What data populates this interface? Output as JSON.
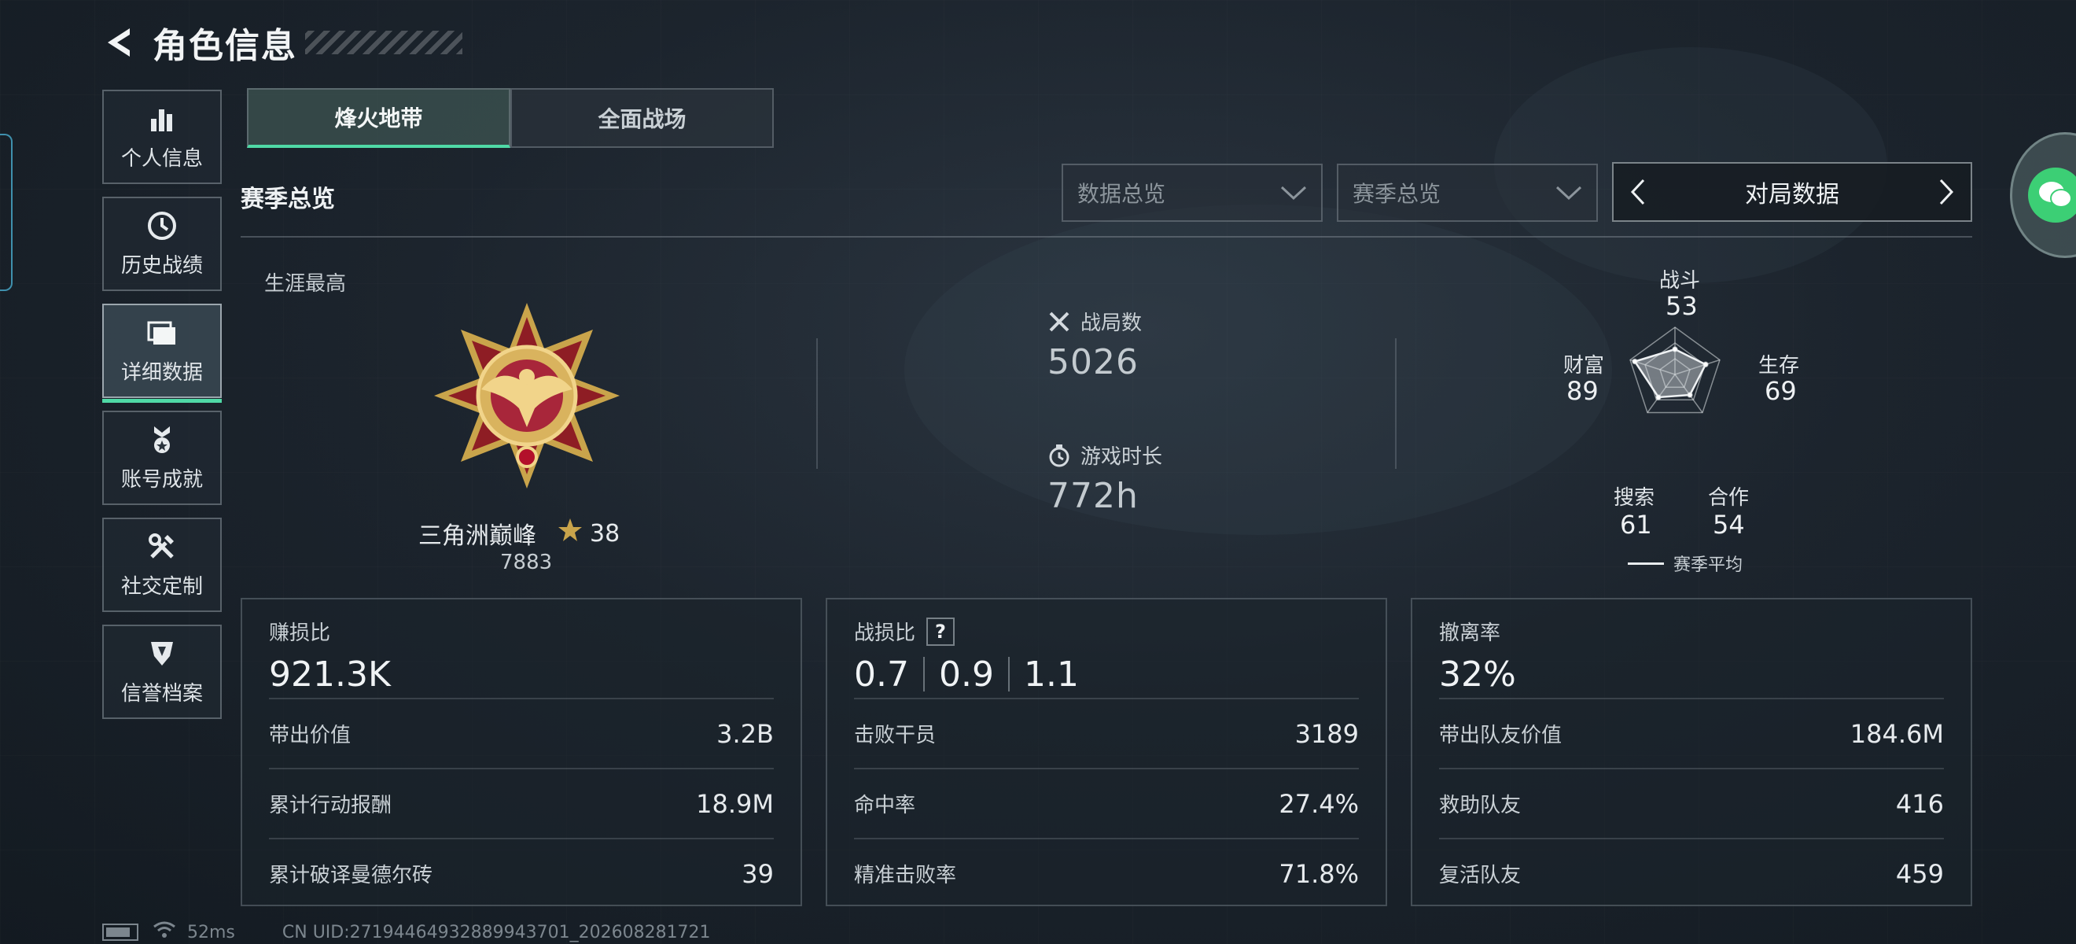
{
  "header": {
    "title": "角色信息"
  },
  "nav": {
    "items": [
      {
        "label": "个人信息",
        "icon": "bar-chart-icon"
      },
      {
        "label": "历史战绩",
        "icon": "clock-icon"
      },
      {
        "label": "详细数据",
        "icon": "folder-icon",
        "active": true
      },
      {
        "label": "账号成就",
        "icon": "medal-icon"
      },
      {
        "label": "社交定制",
        "icon": "tools-icon"
      },
      {
        "label": "信誉档案",
        "icon": "shield-icon"
      }
    ]
  },
  "tabs": [
    {
      "label": "烽火地带",
      "active": true
    },
    {
      "label": "全面战场",
      "active": false
    }
  ],
  "section": {
    "title": "赛季总览",
    "dropdown_data": "数据总览",
    "dropdown_season": "赛季总览",
    "match_switch": "对局数据"
  },
  "career": {
    "label": "生涯最高",
    "rank_name": "三角洲巅峰",
    "stars": "38",
    "score": "7883"
  },
  "summary": {
    "matches_label": "战局数",
    "matches_value": "5026",
    "playtime_label": "游戏时长",
    "playtime_value": "772h"
  },
  "radar": {
    "labels": {
      "combat": "战斗",
      "survival": "生存",
      "teamwork": "合作",
      "search": "搜索",
      "wealth": "财富"
    },
    "values": {
      "combat": "53",
      "survival": "69",
      "teamwork": "54",
      "search": "61",
      "wealth": "89"
    },
    "legend": "赛季平均"
  },
  "cards": {
    "profit": {
      "title": "赚损比",
      "main": "921.3K",
      "rows": [
        {
          "k": "带出价值",
          "v": "3.2B"
        },
        {
          "k": "累计行动报酬",
          "v": "18.9M"
        },
        {
          "k": "累计破译曼德尔砖",
          "v": "39"
        }
      ]
    },
    "kd": {
      "title": "战损比",
      "help": "?",
      "ratios": [
        "0.7",
        "0.9",
        "1.1"
      ],
      "rows": [
        {
          "k": "击败干员",
          "v": "3189"
        },
        {
          "k": "命中率",
          "v": "27.4%"
        },
        {
          "k": "精准击败率",
          "v": "71.8%"
        }
      ]
    },
    "extract": {
      "title": "撤离率",
      "main": "32%",
      "rows": [
        {
          "k": "带出队友价值",
          "v": "184.6M"
        },
        {
          "k": "救助队友",
          "v": "416"
        },
        {
          "k": "复活队友",
          "v": "459"
        }
      ]
    }
  },
  "status": {
    "ping": "52ms",
    "uid": "CN UID:27194464932889943701_202608281721"
  },
  "colors": {
    "accent": "#4fd9a6",
    "chat_green": "#3ccf75"
  }
}
